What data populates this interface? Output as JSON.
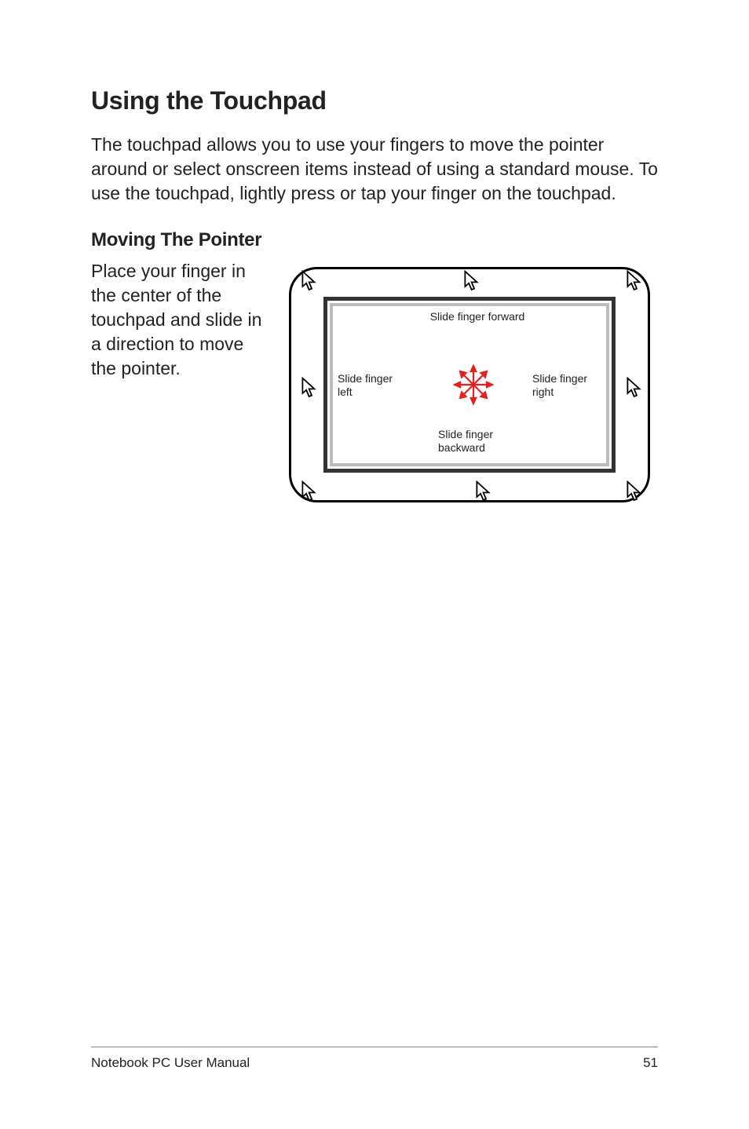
{
  "heading": "Using the Touchpad",
  "intro": "The touchpad allows you to use your fingers to move the pointer around or select onscreen items instead of using a standard mouse. To use the touchpad, lightly press or tap your finger on the touchpad.",
  "subheading": "Moving The Pointer",
  "subtext": "Place your finger in the center of the touchpad and slide in a direction to move the pointer.",
  "diagram": {
    "forward": "Slide finger forward",
    "left_line1": "Slide finger",
    "left_line2": "left",
    "right_line1": "Slide finger",
    "right_line2": "right",
    "back_line1": "Slide finger",
    "back_line2": "backward"
  },
  "footer": {
    "title": "Notebook PC User Manual",
    "page": "51"
  }
}
